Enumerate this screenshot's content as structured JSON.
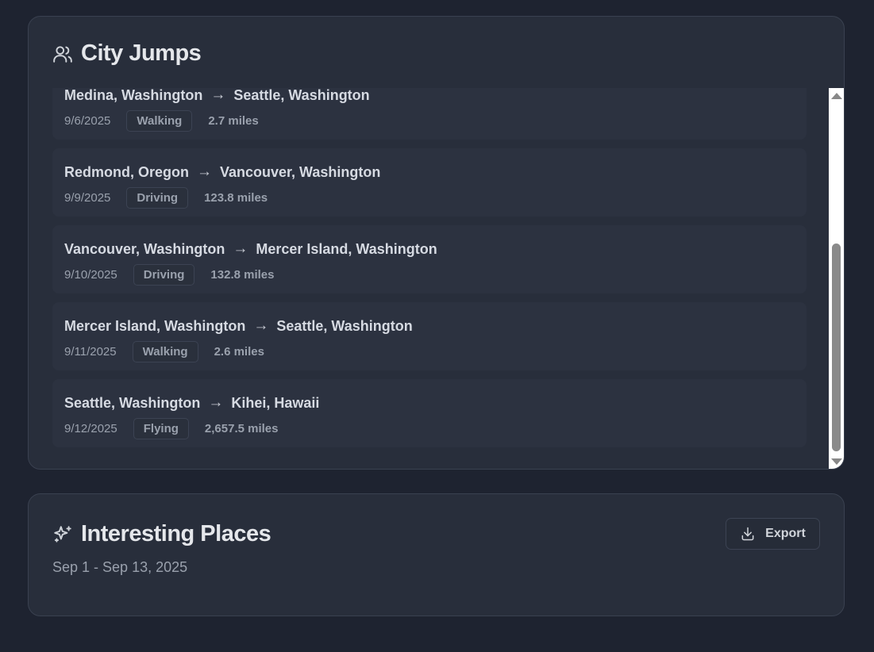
{
  "city_jumps": {
    "title": "City Jumps",
    "icon": "users-icon",
    "items": [
      {
        "from": "Medina, Washington",
        "to": "Seattle, Washington",
        "date": "9/6/2025",
        "mode": "Walking",
        "distance": "2.7 miles"
      },
      {
        "from": "Redmond, Oregon",
        "to": "Vancouver, Washington",
        "date": "9/9/2025",
        "mode": "Driving",
        "distance": "123.8 miles"
      },
      {
        "from": "Vancouver, Washington",
        "to": "Mercer Island, Washington",
        "date": "9/10/2025",
        "mode": "Driving",
        "distance": "132.8 miles"
      },
      {
        "from": "Mercer Island, Washington",
        "to": "Seattle, Washington",
        "date": "9/11/2025",
        "mode": "Walking",
        "distance": "2.6 miles"
      },
      {
        "from": "Seattle, Washington",
        "to": "Kihei, Hawaii",
        "date": "9/12/2025",
        "mode": "Flying",
        "distance": "2,657.5 miles"
      }
    ],
    "arrow": "→"
  },
  "interesting_places": {
    "title": "Interesting Places",
    "icon": "sparkles-icon",
    "date_range": "Sep 1 - Sep 13, 2025",
    "export_label": "Export",
    "export_icon": "download-icon"
  }
}
